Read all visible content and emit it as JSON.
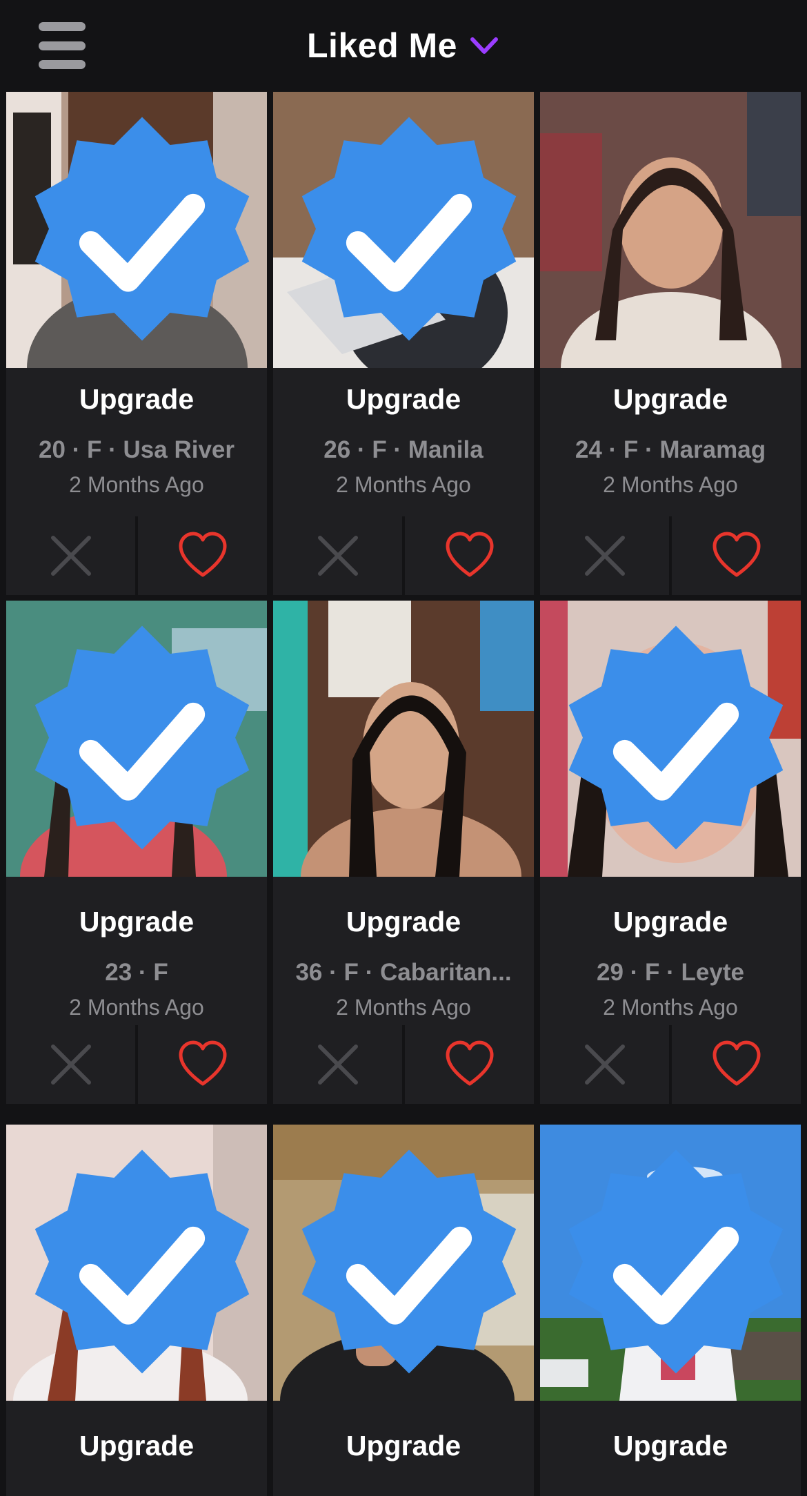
{
  "header": {
    "title": "Liked Me",
    "menu_icon": "hamburger-menu-icon",
    "dropdown_icon": "chevron-down-icon",
    "accent_color": "#9b3dff"
  },
  "colors": {
    "background": "#131315",
    "card": "#1f1f22",
    "heart": "#e8352c",
    "verified": "#3b8eea"
  },
  "cards": [
    {
      "cta": "Upgrade",
      "meta": "20 · F · Usa River",
      "time": "2 Months Ago",
      "verified": true,
      "photo": "woman in gray shirt smiling indoors"
    },
    {
      "cta": "Upgrade",
      "meta": "26 · F · Manila",
      "time": "2 Months Ago",
      "verified": true,
      "photo": "woman on bed with laptop"
    },
    {
      "cta": "Upgrade",
      "meta": "24 · F · Maramag",
      "time": "2 Months Ago",
      "verified": false,
      "photo": "woman in white top selfie"
    },
    {
      "cta": "Upgrade",
      "meta": "23 · F",
      "time": "2 Months Ago",
      "verified": true,
      "photo": "woman in floral top in vehicle"
    },
    {
      "cta": "Upgrade",
      "meta": "36 · F · Cabaritan...",
      "time": "2 Months Ago",
      "verified": false,
      "photo": "woman with long black hair near shelf"
    },
    {
      "cta": "Upgrade",
      "meta": "29 · F · Leyte",
      "time": "2 Months Ago",
      "verified": true,
      "photo": "close-up selfie of woman"
    },
    {
      "cta": "Upgrade",
      "meta": "",
      "time": "",
      "verified": true,
      "photo": "woman with reddish hair in white top"
    },
    {
      "cta": "Upgrade",
      "meta": "",
      "time": "",
      "verified": true,
      "photo": "woman resting chin on hand outdoors"
    },
    {
      "cta": "Upgrade",
      "meta": "",
      "time": "",
      "verified": true,
      "photo": "woman in white jacket under blue sky"
    }
  ],
  "actions": {
    "dismiss_icon": "close-x-icon",
    "like_icon": "heart-outline-icon"
  }
}
